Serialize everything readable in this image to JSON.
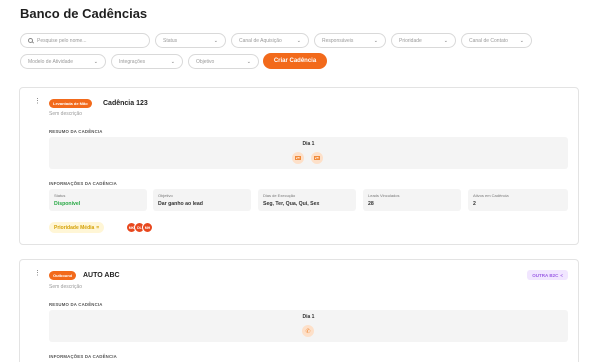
{
  "page": {
    "title": "Banco de Cadências"
  },
  "filters": {
    "search_placeholder": "Pesquise pelo nome...",
    "status": "Status",
    "canal_aquisicao": "Canal de Aquisição",
    "responsaveis": "Responsáveis",
    "prioridade": "Prioridade",
    "canal_contato": "Canal de Contato",
    "modelo_atividade": "Modelo de Atividade",
    "integracoes": "Integrações",
    "objetivo": "Objetivo",
    "chevron": "⌄",
    "create_label": "Criar Cadência"
  },
  "cards": [
    {
      "tag": "Levantada de Mão",
      "tag_color": "#f26a1b",
      "name": "Cadência 123",
      "description": "Sem descrição",
      "summary_label": "RESUMO DA CADÊNCIA",
      "day_label": "Dia 1",
      "day_icons": [
        "mail-icon",
        "mail-icon"
      ],
      "info_label": "INFORMAÇÕES DA CADÊNCIA",
      "info": {
        "status_key": "Status",
        "status_value": "Disponível",
        "objetivo_key": "Objetivo",
        "objetivo_value": "Dar ganho ao lead",
        "dias_key": "Dias de Execução",
        "dias_value": "Seg, Ter, Qua, Qui, Sex",
        "leads_key": "Leads Vinculados",
        "leads_value": "28",
        "ativos_key": "Ativos em Cadência",
        "ativos_value": "2"
      },
      "priority": "Prioridade Média",
      "priority_icon": "=",
      "avatars": [
        "MK",
        "DL",
        "MH"
      ]
    },
    {
      "tag": "Outbound",
      "tag_color": "#f26a1b",
      "name": "AUTO ABC",
      "description": "Sem descrição",
      "type_badge": "OUTRA B2C",
      "type_badge_icon": "<",
      "summary_label": "RESUMO DA CADÊNCIA",
      "day_label": "Dia 1",
      "day_icons": [
        "phone-icon"
      ],
      "phone_glyph": "✆",
      "info_label": "INFORMAÇÕES DA CADÊNCIA"
    }
  ],
  "kebab_glyph": "⋮"
}
